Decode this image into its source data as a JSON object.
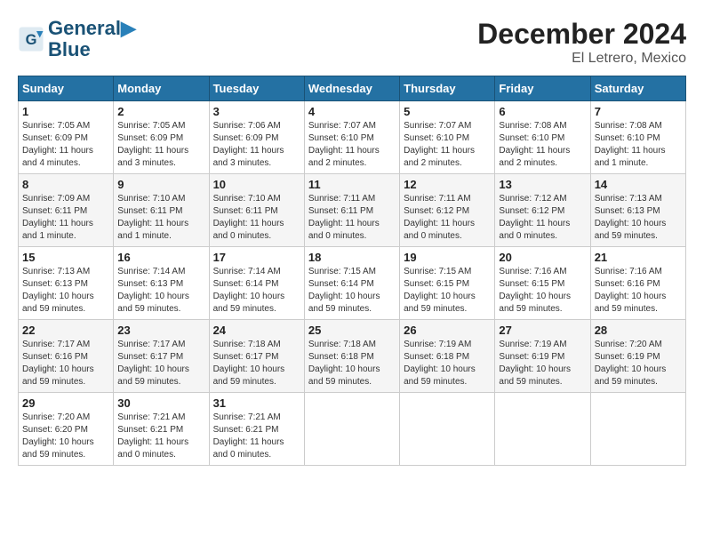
{
  "logo": {
    "line1": "General",
    "line2": "Blue"
  },
  "title": "December 2024",
  "subtitle": "El Letrero, Mexico",
  "days_of_week": [
    "Sunday",
    "Monday",
    "Tuesday",
    "Wednesday",
    "Thursday",
    "Friday",
    "Saturday"
  ],
  "weeks": [
    [
      {
        "day": "1",
        "sunrise": "7:05 AM",
        "sunset": "6:09 PM",
        "daylight": "11 hours and 4 minutes."
      },
      {
        "day": "2",
        "sunrise": "7:05 AM",
        "sunset": "6:09 PM",
        "daylight": "11 hours and 3 minutes."
      },
      {
        "day": "3",
        "sunrise": "7:06 AM",
        "sunset": "6:09 PM",
        "daylight": "11 hours and 3 minutes."
      },
      {
        "day": "4",
        "sunrise": "7:07 AM",
        "sunset": "6:10 PM",
        "daylight": "11 hours and 2 minutes."
      },
      {
        "day": "5",
        "sunrise": "7:07 AM",
        "sunset": "6:10 PM",
        "daylight": "11 hours and 2 minutes."
      },
      {
        "day": "6",
        "sunrise": "7:08 AM",
        "sunset": "6:10 PM",
        "daylight": "11 hours and 2 minutes."
      },
      {
        "day": "7",
        "sunrise": "7:08 AM",
        "sunset": "6:10 PM",
        "daylight": "11 hours and 1 minute."
      }
    ],
    [
      {
        "day": "8",
        "sunrise": "7:09 AM",
        "sunset": "6:11 PM",
        "daylight": "11 hours and 1 minute."
      },
      {
        "day": "9",
        "sunrise": "7:10 AM",
        "sunset": "6:11 PM",
        "daylight": "11 hours and 1 minute."
      },
      {
        "day": "10",
        "sunrise": "7:10 AM",
        "sunset": "6:11 PM",
        "daylight": "11 hours and 0 minutes."
      },
      {
        "day": "11",
        "sunrise": "7:11 AM",
        "sunset": "6:11 PM",
        "daylight": "11 hours and 0 minutes."
      },
      {
        "day": "12",
        "sunrise": "7:11 AM",
        "sunset": "6:12 PM",
        "daylight": "11 hours and 0 minutes."
      },
      {
        "day": "13",
        "sunrise": "7:12 AM",
        "sunset": "6:12 PM",
        "daylight": "11 hours and 0 minutes."
      },
      {
        "day": "14",
        "sunrise": "7:13 AM",
        "sunset": "6:13 PM",
        "daylight": "10 hours and 59 minutes."
      }
    ],
    [
      {
        "day": "15",
        "sunrise": "7:13 AM",
        "sunset": "6:13 PM",
        "daylight": "10 hours and 59 minutes."
      },
      {
        "day": "16",
        "sunrise": "7:14 AM",
        "sunset": "6:13 PM",
        "daylight": "10 hours and 59 minutes."
      },
      {
        "day": "17",
        "sunrise": "7:14 AM",
        "sunset": "6:14 PM",
        "daylight": "10 hours and 59 minutes."
      },
      {
        "day": "18",
        "sunrise": "7:15 AM",
        "sunset": "6:14 PM",
        "daylight": "10 hours and 59 minutes."
      },
      {
        "day": "19",
        "sunrise": "7:15 AM",
        "sunset": "6:15 PM",
        "daylight": "10 hours and 59 minutes."
      },
      {
        "day": "20",
        "sunrise": "7:16 AM",
        "sunset": "6:15 PM",
        "daylight": "10 hours and 59 minutes."
      },
      {
        "day": "21",
        "sunrise": "7:16 AM",
        "sunset": "6:16 PM",
        "daylight": "10 hours and 59 minutes."
      }
    ],
    [
      {
        "day": "22",
        "sunrise": "7:17 AM",
        "sunset": "6:16 PM",
        "daylight": "10 hours and 59 minutes."
      },
      {
        "day": "23",
        "sunrise": "7:17 AM",
        "sunset": "6:17 PM",
        "daylight": "10 hours and 59 minutes."
      },
      {
        "day": "24",
        "sunrise": "7:18 AM",
        "sunset": "6:17 PM",
        "daylight": "10 hours and 59 minutes."
      },
      {
        "day": "25",
        "sunrise": "7:18 AM",
        "sunset": "6:18 PM",
        "daylight": "10 hours and 59 minutes."
      },
      {
        "day": "26",
        "sunrise": "7:19 AM",
        "sunset": "6:18 PM",
        "daylight": "10 hours and 59 minutes."
      },
      {
        "day": "27",
        "sunrise": "7:19 AM",
        "sunset": "6:19 PM",
        "daylight": "10 hours and 59 minutes."
      },
      {
        "day": "28",
        "sunrise": "7:20 AM",
        "sunset": "6:19 PM",
        "daylight": "10 hours and 59 minutes."
      }
    ],
    [
      {
        "day": "29",
        "sunrise": "7:20 AM",
        "sunset": "6:20 PM",
        "daylight": "10 hours and 59 minutes."
      },
      {
        "day": "30",
        "sunrise": "7:21 AM",
        "sunset": "6:21 PM",
        "daylight": "11 hours and 0 minutes."
      },
      {
        "day": "31",
        "sunrise": "7:21 AM",
        "sunset": "6:21 PM",
        "daylight": "11 hours and 0 minutes."
      },
      null,
      null,
      null,
      null
    ]
  ],
  "labels": {
    "sunrise": "Sunrise: ",
    "sunset": "Sunset: ",
    "daylight": "Daylight: "
  }
}
